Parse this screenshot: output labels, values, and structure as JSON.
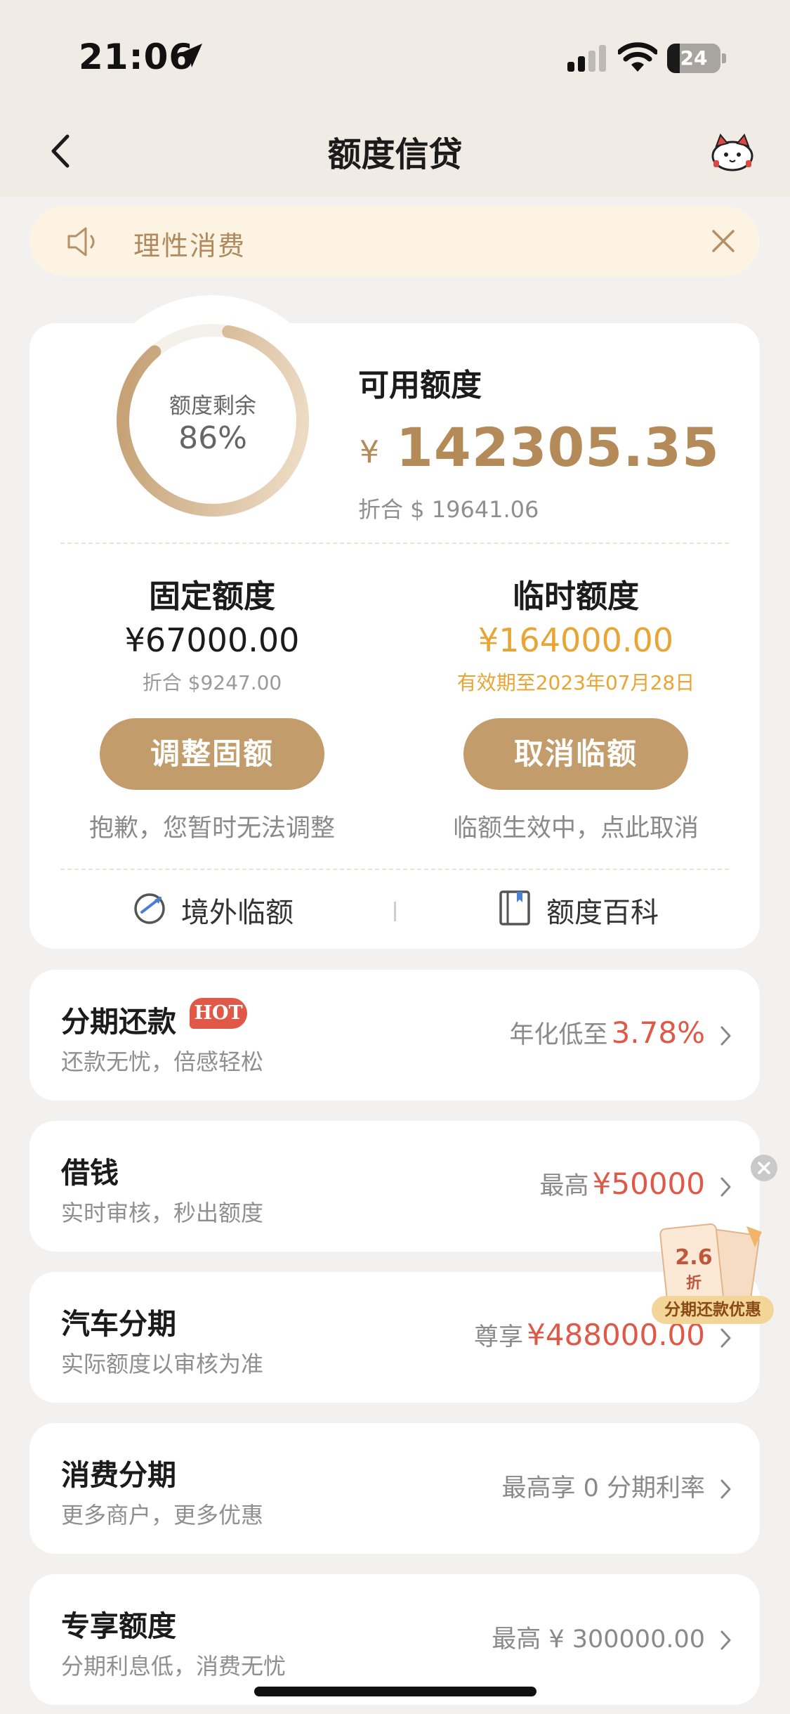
{
  "status_bar": {
    "time": "21:06",
    "battery": "24",
    "battery_level": 0.24
  },
  "header": {
    "title": "额度信贷"
  },
  "notice": {
    "text": "理性消费"
  },
  "summary": {
    "ring_label": "额度剩余",
    "ring_value": "86%",
    "ring_fraction": 0.86,
    "available_title": "可用额度",
    "available_currency": "¥",
    "available_amount": "142305.35",
    "available_usd": "折合 $ 19641.06"
  },
  "fixed": {
    "title": "固定额度",
    "amount": "¥67000.00",
    "usd": "折合 $9247.00",
    "button": "调整固额",
    "note": "抱歉，您暂时无法调整"
  },
  "temporary": {
    "title": "临时额度",
    "amount": "¥164000.00",
    "validity": "有效期至2023年07月28日",
    "button": "取消临额",
    "note": "临额生效中，点此取消"
  },
  "links": {
    "overseas": "境外临额",
    "encyclopedia": "额度百科"
  },
  "rows": [
    {
      "title": "分期还款",
      "badge": "HOT",
      "subtitle": "还款无忧，倍感轻松",
      "prefix": "年化低至",
      "value": "3.78%"
    },
    {
      "title": "借钱",
      "subtitle": "实时审核，秒出额度",
      "prefix": "最高",
      "value": "¥50000"
    },
    {
      "title": "汽车分期",
      "subtitle": "实际额度以审核为准",
      "prefix": "尊享",
      "value": "¥488000.00"
    },
    {
      "title": "消费分期",
      "subtitle": "更多商户，更多优惠",
      "text": "最高享 0 分期利率"
    },
    {
      "title": "专享额度",
      "subtitle": "分期利息低，消费无忧",
      "text": "最高 ¥ 300000.00"
    }
  ],
  "promo": {
    "discount": "2.6",
    "unit": "折",
    "label": "分期还款优惠"
  },
  "colors": {
    "accent": "#c29c6b",
    "gold": "#b38a58",
    "orange": "#e8a533",
    "red": "#e05848"
  }
}
